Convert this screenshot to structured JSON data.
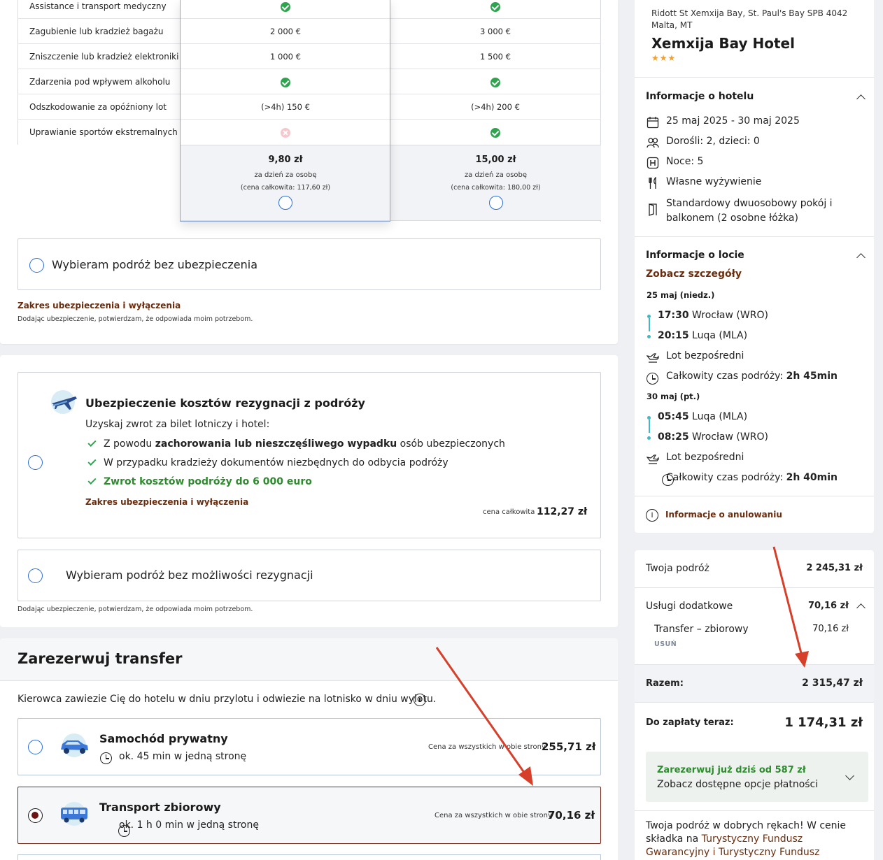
{
  "insurance_table": {
    "rows": [
      {
        "label": "Assistance i transport medyczny",
        "c1": "",
        "c1_icon": "check-icon",
        "c2": "",
        "c2_icon": "check-icon"
      },
      {
        "label": "Zagubienie lub kradzież bagażu",
        "c1": "2 000 €",
        "c2": "3 000 €"
      },
      {
        "label": "Zniszczenie lub kradzież elektroniki",
        "c1": "1 000 €",
        "c2": "1 500 €"
      },
      {
        "label": "Zdarzenia pod wpływem alkoholu",
        "c1": "",
        "c1_icon": "check-icon",
        "c2": "",
        "c2_icon": "check-icon"
      },
      {
        "label": "Odszkodowanie za opóźniony lot",
        "c1": "(>4h) 150 €",
        "c2": "(>4h) 200 €"
      },
      {
        "label": "Uprawianie sportów ekstremalnych",
        "c1": "",
        "c1_icon": "cross-icon",
        "c2": "",
        "c2_icon": "check-icon"
      }
    ],
    "plans": [
      {
        "price": "9,80 zł",
        "per": "za dzień za osobę",
        "total": "(cena całkowita: 117,60 zł)"
      },
      {
        "price": "15,00 zł",
        "per": "za dzień za osobę",
        "total": "(cena całkowita: 180,00 zł)"
      }
    ],
    "no_insurance_label": "Wybieram podróż bez ubezpieczenia",
    "scope_link": "Zakres ubezpieczenia i wyłączenia",
    "disclaimer": "Dodając ubezpieczenie, potwierdzam, że odpowiada moim potrzebom."
  },
  "cancellation": {
    "title": "Ubezpieczenie kosztów rezygnacji z podróży",
    "intro": "Uzyskaj zwrot za bilet lotniczy i hotel:",
    "benefit1_pre": "Z powodu ",
    "benefit1_bold": "zachorowania lub nieszczęśliwego wypadku",
    "benefit1_post": " osób ubezpieczonych",
    "benefit2": "W przypadku kradzieży dokumentów niezbędnych do odbycia podróży",
    "benefit3": "Zwrot kosztów podróży do 6 000 euro",
    "scope_link": "Zakres ubezpieczenia i wyłączenia",
    "price_label": "cena całkowita",
    "price": "112,27 zł",
    "no_cancel_label": "Wybieram podróż bez możliwości rezygnacji",
    "disclaimer": "Dodając ubezpieczenie, potwierdzam, że odpowiada moim potrzebom."
  },
  "transfer": {
    "title": "Zarezerwuj transfer",
    "description": "Kierowca zawiezie Cię do hotelu w dniu przylotu i odwiezie na lotnisko w dniu wylotu.",
    "options": [
      {
        "name": "Samochód prywatny",
        "duration": "ok. 45 min w jedną stronę",
        "price_label": "Cena za wszystkich w obie strony",
        "price": "255,71 zł",
        "selected": false
      },
      {
        "name": "Transport zbiorowy",
        "duration": "ok. 1 h 0 min w jedną stronę",
        "price_label": "Cena za wszystkich w obie strony",
        "price": "70,16 zł",
        "selected": true
      }
    ]
  },
  "hotel": {
    "address": "Ridott St Xemxija Bay, St. Paul's Bay SPB 4042 Malta, MT",
    "name": "Xemxija Bay Hotel",
    "stars": "★★★",
    "info_title": "Informacje o hotelu",
    "dates": "25 maj 2025 - 30 maj 2025",
    "guests": "Dorośli: 2, dzieci: 0",
    "nights": "Noce: 5",
    "board": "Własne wyżywienie",
    "room": "Standardowy dwuosobowy pokój i balkonem (2 osobne łóżka)"
  },
  "flight": {
    "title": "Informacje o locie",
    "details_link": "Zobacz szczegóły",
    "outbound": {
      "date": "25 maj (niedz.)",
      "dep_time": "17:30",
      "dep_place": " Wrocław (WRO)",
      "arr_time": "20:15",
      "arr_place": " Luqa (MLA)",
      "type": "Lot bezpośredni",
      "duration_label": "Całkowity czas podróży: ",
      "duration": "2h 45min"
    },
    "return": {
      "date": "30 maj (pt.)",
      "dep_time": "05:45",
      "dep_place": " Luqa (MLA)",
      "arr_time": "08:25",
      "arr_place": " Wrocław (WRO)",
      "type": "Lot bezpośredni",
      "duration_label": "Całkowity czas podróży: ",
      "duration": "2h 40min"
    },
    "cancel_info": "Informacje o anulowaniu"
  },
  "summary": {
    "trip_label": "Twoja podróż",
    "trip_value": "2 245,31 zł",
    "extras_label": "Usługi dodatkowe",
    "extras_value": "70,16 zł",
    "transfer_label": "Transfer – zbiorowy",
    "transfer_value": "70,16 zł",
    "remove": "USUŃ",
    "total_label": "Razem:",
    "total_value": "2 315,47 zł",
    "pay_now_label": "Do zapłaty teraz:",
    "pay_now_value": "1 174,31 zł",
    "promo_title": "Zarezerwuj już dziś od 587 zł",
    "promo_sub": "Zobacz dostępne opcje płatności",
    "footer_text": "Twoja podróż w dobrych rękach! W cenie składka na ",
    "footer_link": "Turystyczny Fundusz Gwarancyjny i Turystyczny Fundusz Pomocowy"
  },
  "colors": {
    "accent_brown": "#6b2d0e",
    "green": "#2ea44f",
    "arrow_red": "#d6402a",
    "timeline": "#3fb8c9"
  }
}
